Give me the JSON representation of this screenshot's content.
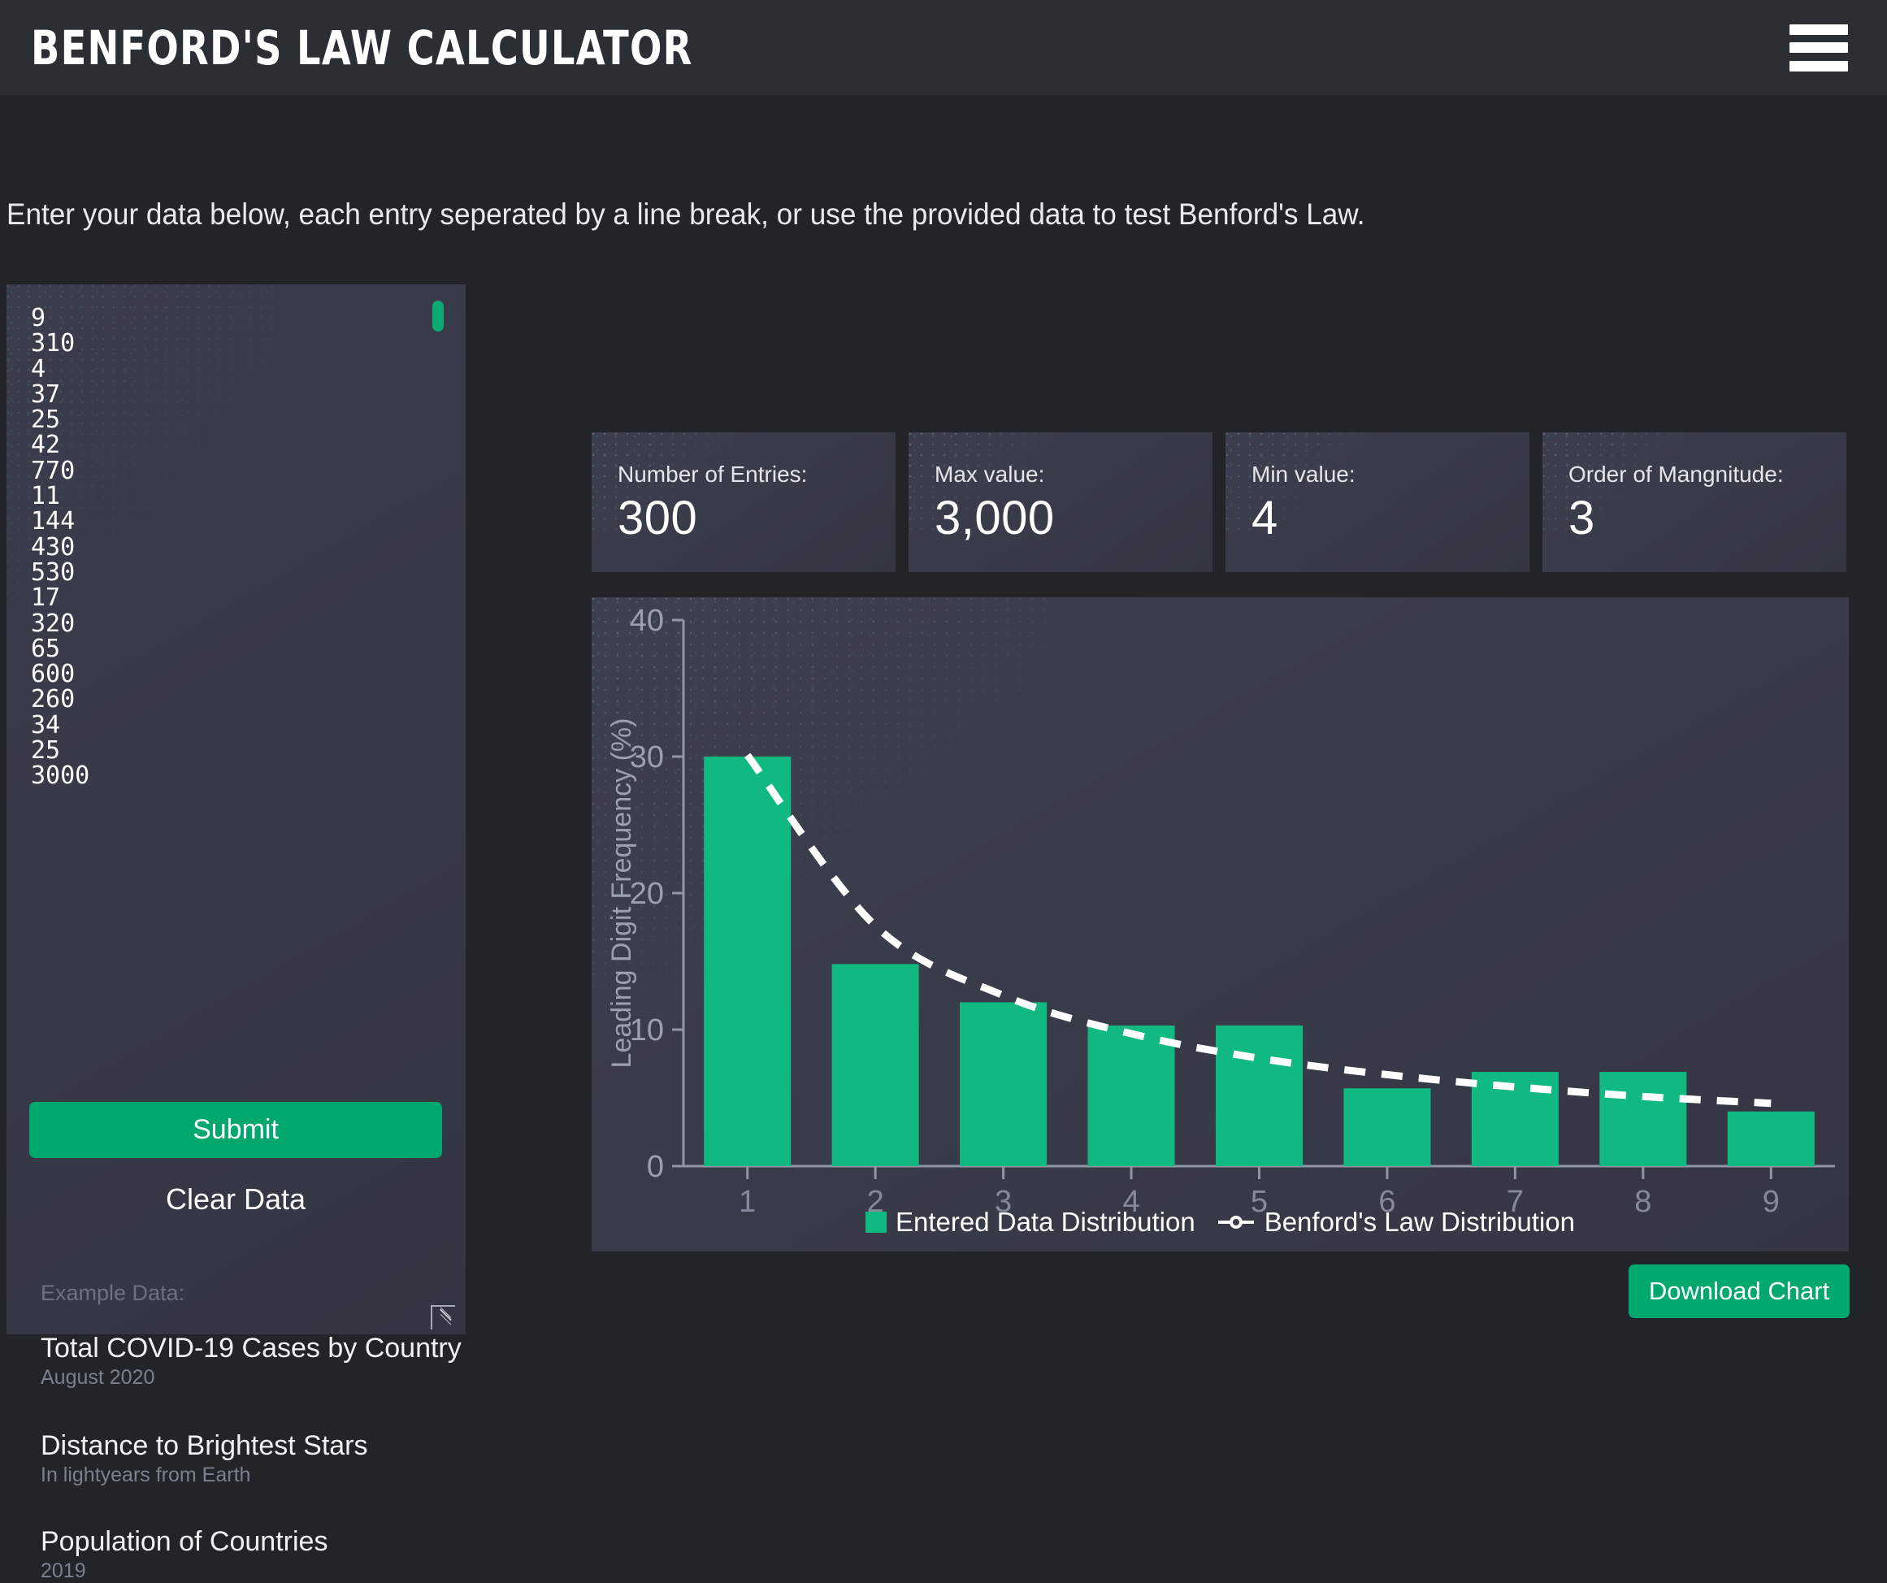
{
  "header": {
    "title": "BENFORD'S LAW CALCULATOR",
    "menu_icon": "hamburger-menu-icon"
  },
  "intro": {
    "text": "Enter your data below, each entry seperated by a line break, or use the provided data to test Benford's Law."
  },
  "input_panel": {
    "textarea_value": "9\n310\n4\n37\n25\n42\n770\n11\n144\n430\n530\n17\n320\n65\n600\n260\n34\n25\n3000",
    "submit_label": "Submit",
    "clear_label": "Clear Data",
    "example_label": "Example Data:",
    "examples": [
      {
        "title": "Total COVID-19 Cases by Country",
        "subtitle": "August 2020"
      },
      {
        "title": "Distance to Brightest Stars",
        "subtitle": "In lightyears from Earth"
      },
      {
        "title": "Population of Countries",
        "subtitle": "2019"
      }
    ]
  },
  "stats": [
    {
      "label": "Number of Entries:",
      "value": "300"
    },
    {
      "label": "Max value:",
      "value": "3,000"
    },
    {
      "label": "Min value:",
      "value": "4"
    },
    {
      "label": "Order of Mangnitude:",
      "value": "3"
    }
  ],
  "download": {
    "label": "Download Chart"
  },
  "colors": {
    "accent_green": "#00a86e",
    "bar_green": "#10b981",
    "page_bg": "#212429",
    "panel_bg": "#393c49",
    "header_bg": "#2b2e33"
  },
  "chart_data": {
    "type": "bar",
    "title": "",
    "xlabel": "",
    "ylabel": "Leading Digit Frequency (%)",
    "categories": [
      "1",
      "2",
      "3",
      "4",
      "5",
      "6",
      "7",
      "8",
      "9"
    ],
    "ylim": [
      0,
      40
    ],
    "yticks": [
      0,
      10,
      20,
      30,
      40
    ],
    "grid": false,
    "legend_position": "bottom",
    "series": [
      {
        "name": "Entered Data Distribution",
        "type": "bar",
        "color": "#10b981",
        "values": [
          30.0,
          14.8,
          12.0,
          10.3,
          10.3,
          5.7,
          6.9,
          6.9,
          4.0
        ]
      },
      {
        "name": "Benford's Law Distribution",
        "type": "line",
        "style": "dashed",
        "color": "#ffffff",
        "values": [
          30.1,
          17.6,
          12.5,
          9.7,
          7.9,
          6.7,
          5.8,
          5.1,
          4.6
        ]
      }
    ]
  }
}
